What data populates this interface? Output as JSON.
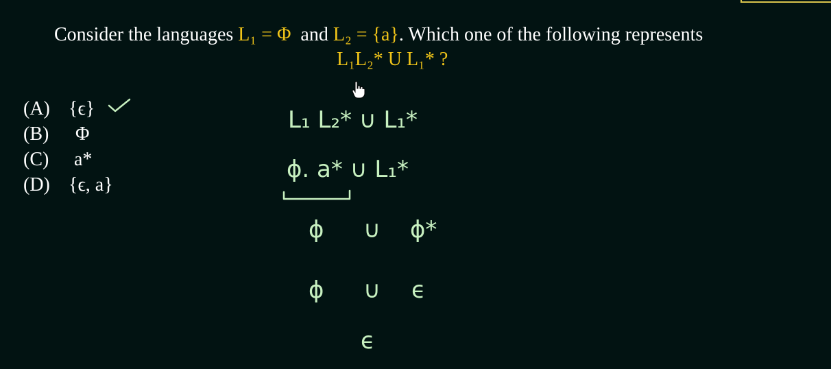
{
  "question": {
    "intro": "Consider the languages ",
    "l1": "L₁ = Φ",
    "mid": "  and ",
    "l2": "L₂ = {a}",
    "rest": ". Which one of the following represents",
    "expression": "L₁L₂* U L₁* ?"
  },
  "options": [
    {
      "letter": "(A)",
      "value": "{ϵ}"
    },
    {
      "letter": "(B)",
      "value": "Φ"
    },
    {
      "letter": "(C)",
      "value": "a*"
    },
    {
      "letter": "(D)",
      "value": "{ϵ, a}"
    }
  ],
  "handwritten_steps": {
    "step1": "L₁ L₂*  ∪  L₁*",
    "step2": "ϕ. a*  ∪  L₁*",
    "step3_left": "ϕ",
    "step3_union": "∪",
    "step3_right": "ϕ*",
    "step4_left": "ϕ",
    "step4_union": "∪",
    "step4_right": "ϵ",
    "step5": "ϵ"
  },
  "colors": {
    "background": "#021312",
    "text": "#ffffff",
    "highlight": "#f0c419",
    "chalk": "#c7f0c0"
  },
  "icons": {
    "check": "check-mark-icon",
    "cursor": "hand-cursor-icon"
  }
}
